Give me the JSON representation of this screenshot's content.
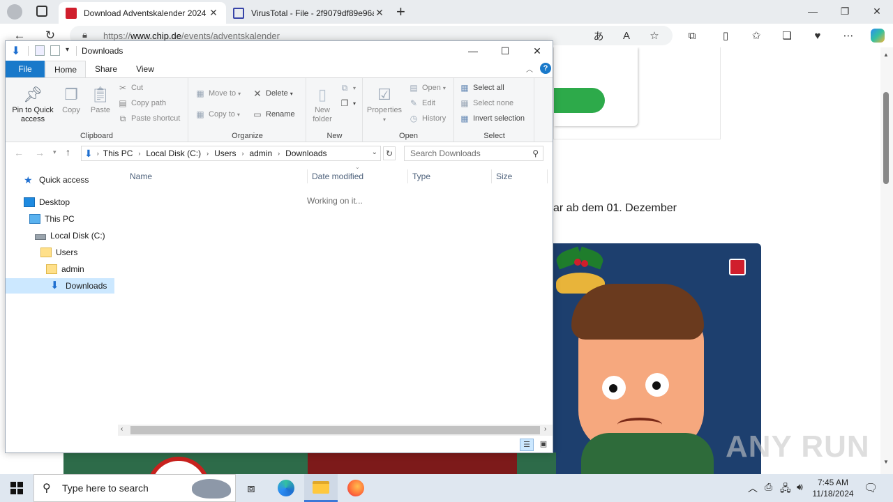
{
  "browser": {
    "tabs": [
      {
        "title": "Download Adventskalender 2024",
        "favicon_color": "#d01e2c"
      },
      {
        "title": "VirusTotal - File - 2f9079df89e96a",
        "favicon_color": "#3845a8"
      }
    ],
    "new_tab": "+",
    "url": "https://www.chip.de/events/adventskalender",
    "url_host": "www.chip.de",
    "url_path": "/events/adventskalender"
  },
  "webpage": {
    "visible_text": "ar ab dem 01. Dezember",
    "watermark": "ANY RUN"
  },
  "explorer": {
    "title": "Downloads",
    "ribbon_tabs": [
      "File",
      "Home",
      "Share",
      "View"
    ],
    "groups": {
      "clipboard": {
        "label": "Clipboard",
        "pin_line1": "Pin to Quick",
        "pin_line2": "access",
        "copy": "Copy",
        "paste": "Paste",
        "cut": "Cut",
        "copy_path": "Copy path",
        "paste_shortcut": "Paste shortcut"
      },
      "organize": {
        "label": "Organize",
        "move_to": "Move to",
        "copy_to": "Copy to",
        "delete": "Delete",
        "rename": "Rename"
      },
      "new": {
        "label": "New",
        "new_folder_line1": "New",
        "new_folder_line2": "folder"
      },
      "open": {
        "label": "Open",
        "properties": "Properties",
        "open": "Open",
        "edit": "Edit",
        "history": "History"
      },
      "select": {
        "label": "Select",
        "select_all": "Select all",
        "select_none": "Select none",
        "invert": "Invert selection"
      }
    },
    "breadcrumb": [
      "This PC",
      "Local Disk (C:)",
      "Users",
      "admin",
      "Downloads"
    ],
    "search_placeholder": "Search Downloads",
    "nav": {
      "quick_access": "Quick access",
      "desktop": "Desktop",
      "this_pc": "This PC",
      "local_disk": "Local Disk (C:)",
      "users": "Users",
      "admin": "admin",
      "downloads": "Downloads"
    },
    "columns": [
      "Name",
      "Date modified",
      "Type",
      "Size"
    ],
    "status_message": "Working on it..."
  },
  "taskbar": {
    "search_placeholder": "Type here to search",
    "time": "7:45 AM",
    "date": "11/18/2024"
  }
}
